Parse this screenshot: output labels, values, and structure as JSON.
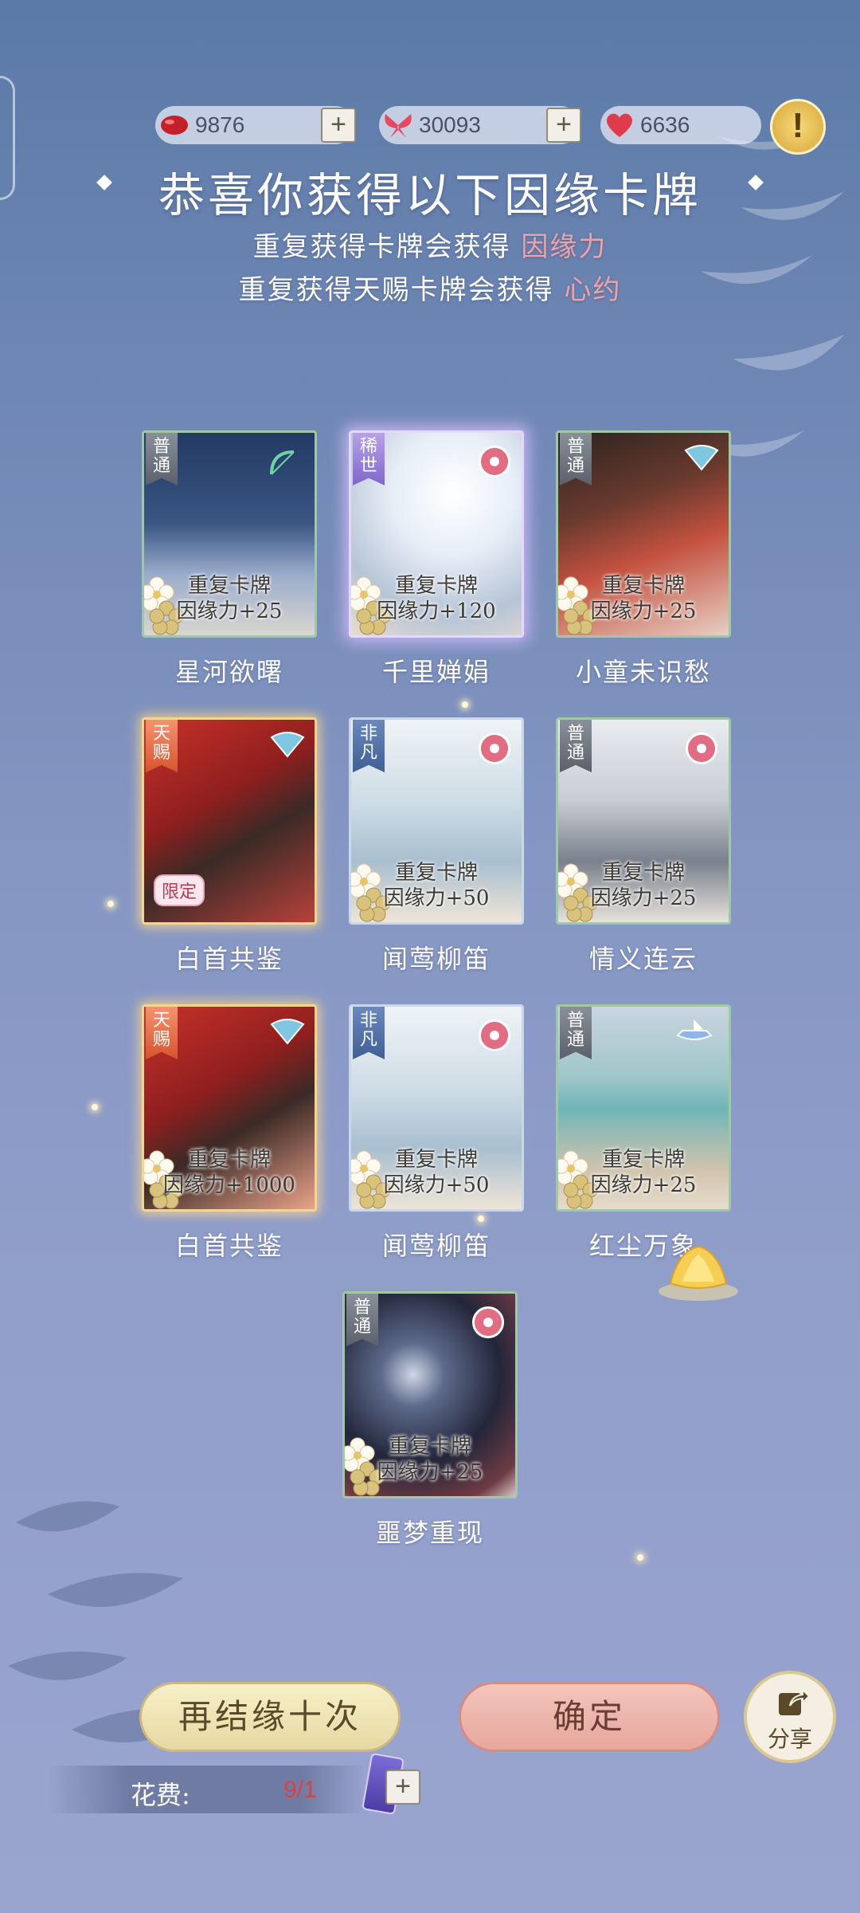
{
  "currencies": [
    {
      "icon": "red-gem-icon",
      "value": "9876"
    },
    {
      "icon": "pink-butterfly-icon",
      "value": "30093"
    },
    {
      "icon": "red-heart-icon",
      "value": "6636"
    }
  ],
  "header": {
    "title": "恭喜你获得以下因缘卡牌",
    "line1_prefix": "重复获得卡牌会获得 ",
    "line1_highlight": "因缘力",
    "line2_prefix": "重复获得天赐卡牌会获得 ",
    "line2_highlight": "心约"
  },
  "cards": [
    {
      "tag": "普通",
      "rarity": "common",
      "dup": "重复卡牌",
      "reward": "因缘力+25",
      "name": "星河欲曙"
    },
    {
      "tag": "稀世",
      "rarity": "super",
      "dup": "重复卡牌",
      "reward": "因缘力+120",
      "name": "千里婵娟"
    },
    {
      "tag": "普通",
      "rarity": "common",
      "dup": "重复卡牌",
      "reward": "因缘力+25",
      "name": "小童未识愁"
    },
    {
      "tag": "天赐",
      "rarity": "rare",
      "dup": "",
      "reward": "",
      "name": "白首共鉴",
      "badge": "限定"
    },
    {
      "tag": "非凡",
      "rarity": "fine",
      "dup": "重复卡牌",
      "reward": "因缘力+50",
      "name": "闻莺柳笛"
    },
    {
      "tag": "普通",
      "rarity": "common",
      "dup": "重复卡牌",
      "reward": "因缘力+25",
      "name": "情义连云"
    },
    {
      "tag": "天赐",
      "rarity": "rare",
      "dup": "重复卡牌",
      "reward": "因缘力+1000",
      "name": "白首共鉴"
    },
    {
      "tag": "非凡",
      "rarity": "fine",
      "dup": "重复卡牌",
      "reward": "因缘力+50",
      "name": "闻莺柳笛"
    },
    {
      "tag": "普通",
      "rarity": "common",
      "dup": "重复卡牌",
      "reward": "因缘力+25",
      "name": "红尘万象"
    },
    {
      "tag": "普通",
      "rarity": "common",
      "dup": "重复卡牌",
      "reward": "因缘力+25",
      "name": "噩梦重现"
    }
  ],
  "buttons": {
    "again": "再结缘十次",
    "confirm": "确定",
    "share": "分享"
  },
  "cost": {
    "label": "花费:",
    "value": "9/1"
  },
  "colors": {
    "highlight": "#f2a1a6",
    "common": "#9dc9a6",
    "super": "#e6d7ff",
    "fine": "#c9d7ec",
    "rare": "#f3d58c"
  }
}
